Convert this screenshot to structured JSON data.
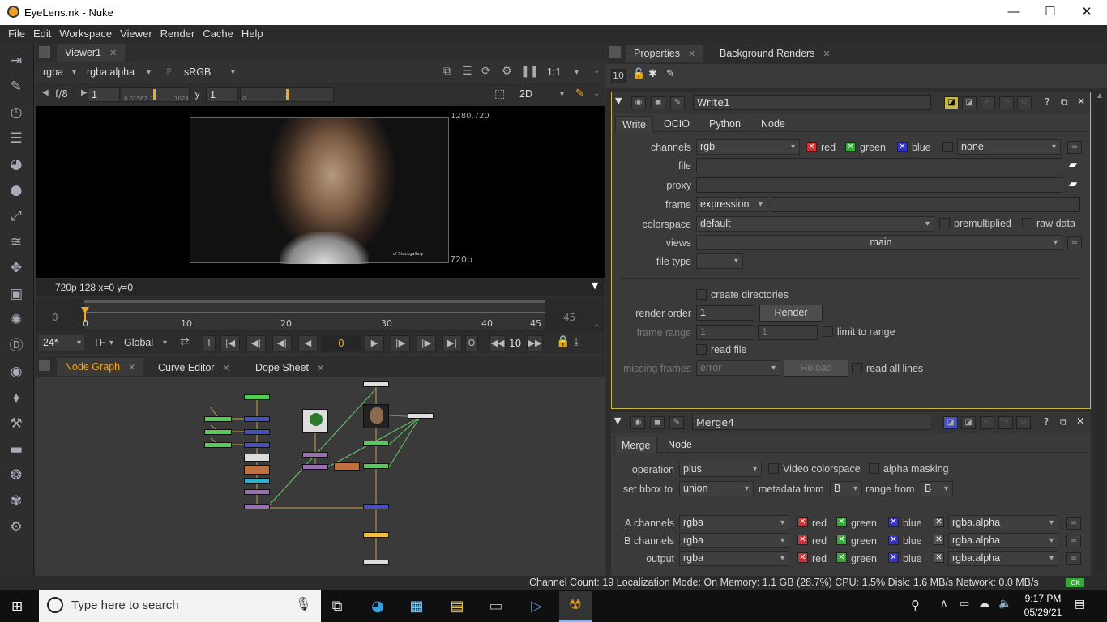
{
  "window": {
    "title": "EyeLens.nk - Nuke",
    "minimize": "—",
    "maximize": "☐",
    "close": "✕"
  },
  "menu": [
    "File",
    "Edit",
    "Workspace",
    "Viewer",
    "Render",
    "Cache",
    "Help"
  ],
  "viewer": {
    "tab": "Viewer1",
    "channels": "rgba",
    "alpha": "rgba.alpha",
    "ip": "IP",
    "lut": "sRGB",
    "zoom": "1:1",
    "mode": "2D",
    "fstop": "f/8",
    "gain": "1",
    "y_label": "y",
    "gamma": "1",
    "slider_ticks": [
      "0.01562",
      "1",
      "1024"
    ],
    "gamma_ticks": [
      "0",
      "1"
    ],
    "format_corner": "1280,720",
    "format_label": "720p",
    "info": "720p 128  x=0 y=0",
    "watermark": "of Stockgallery"
  },
  "timeline": {
    "start": "0",
    "end": "45",
    "current": "0",
    "ticks": [
      "0",
      "10",
      "20",
      "30",
      "40",
      "45"
    ],
    "fps": "24*",
    "tf": "TF",
    "scope": "Global",
    "frame": "0",
    "step": "10"
  },
  "bottom_tabs": [
    "Node Graph",
    "Curve Editor",
    "Dope Sheet"
  ],
  "properties": {
    "tabs": [
      "Properties",
      "Background Renders"
    ],
    "max_panels": "10",
    "write": {
      "name": "Write1",
      "tabs": [
        "Write",
        "OCIO",
        "Python",
        "Node"
      ],
      "channels_label": "channels",
      "channels": "rgb",
      "red": "red",
      "green": "green",
      "blue": "blue",
      "extra": "none",
      "file_label": "file",
      "proxy_label": "proxy",
      "frame_label": "frame",
      "frame": "expression",
      "colorspace_label": "colorspace",
      "colorspace": "default",
      "premultiplied": "premultiplied",
      "raw_data": "raw data",
      "views_label": "views",
      "views": "main",
      "file_type_label": "file type",
      "create_dirs": "create directories",
      "render_order_label": "render order",
      "render_order": "1",
      "render_btn": "Render",
      "frame_range_label": "frame range",
      "fr_start": "1",
      "fr_end": "1",
      "limit": "limit to range",
      "read_file": "read file",
      "missing_label": "missing frames",
      "missing": "error",
      "reload": "Reload",
      "read_all": "read all lines"
    },
    "merge": {
      "name": "Merge4",
      "tabs": [
        "Merge",
        "Node"
      ],
      "operation_label": "operation",
      "operation": "plus",
      "video_cs": "Video colorspace",
      "alpha_mask": "alpha masking",
      "bbox_label": "set bbox to",
      "bbox": "union",
      "meta_label": "metadata from",
      "meta": "B",
      "range_label": "range from",
      "range": "B",
      "rows": [
        {
          "label": "A channels",
          "value": "rgba",
          "red": "red",
          "green": "green",
          "blue": "blue",
          "alpha": "rgba.alpha"
        },
        {
          "label": "B channels",
          "value": "rgba",
          "red": "red",
          "green": "green",
          "blue": "blue",
          "alpha": "rgba.alpha"
        },
        {
          "label": "output",
          "value": "rgba",
          "red": "red",
          "green": "green",
          "blue": "blue",
          "alpha": "rgba.alpha"
        }
      ]
    }
  },
  "status": "Channel Count: 19  Localization Mode: On  Memory: 1.1 GB (28.7%)  CPU: 1.5%  Disk: 1.6 MB/s  Network: 0.0 MB/s",
  "status_ok": "OK",
  "taskbar": {
    "search": "Type here to search",
    "time": "9:17 PM",
    "date": "05/29/21"
  }
}
